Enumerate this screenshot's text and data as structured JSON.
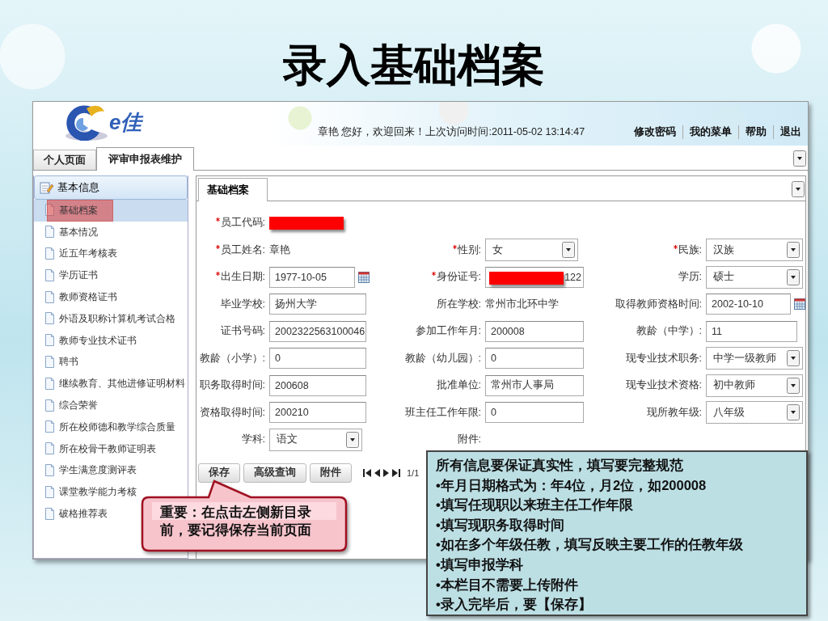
{
  "slide_title": "录入基础档案",
  "header": {
    "logo_text": "e佳",
    "welcome": "章艳 您好，欢迎回来！上次访问时间:2011-05-02 13:14:47",
    "links": [
      "修改密码",
      "我的菜单",
      "帮助",
      "退出"
    ]
  },
  "tabs": [
    {
      "label": "个人页面",
      "selected": false
    },
    {
      "label": "评审申报表维护",
      "selected": true
    }
  ],
  "sidebar": {
    "header": "基本信息",
    "items": [
      {
        "label": "基础档案",
        "selected": true
      },
      {
        "label": "基本情况",
        "selected": false
      },
      {
        "label": "近五年考核表",
        "selected": false
      },
      {
        "label": "学历证书",
        "selected": false
      },
      {
        "label": "教师资格证书",
        "selected": false
      },
      {
        "label": "外语及职称计算机考试合格",
        "selected": false
      },
      {
        "label": "教师专业技术证书",
        "selected": false
      },
      {
        "label": "聘书",
        "selected": false
      },
      {
        "label": "继续教育、其他进修证明材料",
        "selected": false
      },
      {
        "label": "综合荣誉",
        "selected": false
      },
      {
        "label": "所在校师德和教学综合质量",
        "selected": false
      },
      {
        "label": "所在校骨干教师证明表",
        "selected": false
      },
      {
        "label": "学生满意度测评表",
        "selected": false
      },
      {
        "label": "课堂教学能力考核",
        "selected": false
      },
      {
        "label": "破格推荐表",
        "selected": false
      }
    ]
  },
  "content_tabs": [
    {
      "label": "基础档案",
      "selected": true
    }
  ],
  "form": {
    "rows": [
      [
        {
          "label": "员工代码:",
          "required": true,
          "kind": "redacted"
        }
      ],
      [
        {
          "label": "员工姓名:",
          "required": true,
          "kind": "text",
          "value": "章艳"
        },
        {
          "label": "性别:",
          "required": true,
          "kind": "select",
          "value": "女"
        },
        {
          "label": "民族:",
          "required": true,
          "kind": "select",
          "value": "汉族"
        }
      ],
      [
        {
          "label": "出生日期:",
          "required": true,
          "kind": "date",
          "value": "1977-10-05"
        },
        {
          "label": "身份证号:",
          "required": true,
          "kind": "redacted_input",
          "value": "122"
        },
        {
          "label": "学历:",
          "required": false,
          "kind": "select",
          "value": "硕士"
        }
      ],
      [
        {
          "label": "毕业学校:",
          "required": false,
          "kind": "input",
          "value": "扬州大学"
        },
        {
          "label": "所在学校:",
          "required": false,
          "kind": "text",
          "value": "常州市北环中学"
        },
        {
          "label": "取得教师资格时间:",
          "required": false,
          "kind": "date",
          "value": "2002-10-10"
        }
      ],
      [
        {
          "label": "证书号码:",
          "required": false,
          "kind": "input",
          "value": "2002322563100046"
        },
        {
          "label": "参加工作年月:",
          "required": false,
          "kind": "input",
          "value": "200008"
        },
        {
          "label": "教龄（中学）:",
          "required": false,
          "kind": "input",
          "value": "11"
        }
      ],
      [
        {
          "label": "教龄（小学）:",
          "required": false,
          "kind": "input",
          "value": "0"
        },
        {
          "label": "教龄（幼儿园）:",
          "required": false,
          "kind": "input",
          "value": "0"
        },
        {
          "label": "现专业技术职务:",
          "required": false,
          "kind": "select",
          "value": "中学一级教师"
        }
      ],
      [
        {
          "label": "职务取得时间:",
          "required": false,
          "kind": "input",
          "value": "200608"
        },
        {
          "label": "批准单位:",
          "required": false,
          "kind": "input",
          "value": "常州市人事局"
        },
        {
          "label": "现专业技术资格:",
          "required": false,
          "kind": "select",
          "value": "初中教师"
        }
      ],
      [
        {
          "label": "资格取得时间:",
          "required": false,
          "kind": "input",
          "value": "200210"
        },
        {
          "label": "班主任工作年限:",
          "required": false,
          "kind": "input",
          "value": "0"
        },
        {
          "label": "现所教年级:",
          "required": false,
          "kind": "select",
          "value": "八年级"
        }
      ],
      [
        {
          "label": "学科:",
          "required": false,
          "kind": "select",
          "value": "语文"
        },
        {
          "label": "附件:",
          "required": false,
          "kind": "label_only"
        }
      ]
    ]
  },
  "toolbar": {
    "buttons": [
      "保存",
      "高级查询",
      "附件"
    ],
    "page": "1/1"
  },
  "callout": "重要：在点击左侧新目录前，要记得保存当前页面",
  "note": {
    "title": "所有信息要保证真实性，填写要完整规范",
    "bullets": [
      "•年月日期格式为：年4位，月2位，如200008",
      "•填写任现职以来班主任工作年限",
      "•填写现职务取得时间",
      "•如在多个年级任教，填写反映主要工作的任教年级",
      "•填写申报学科",
      "•本栏目不需要上传附件",
      "•录入完毕后，要【保存】"
    ]
  }
}
